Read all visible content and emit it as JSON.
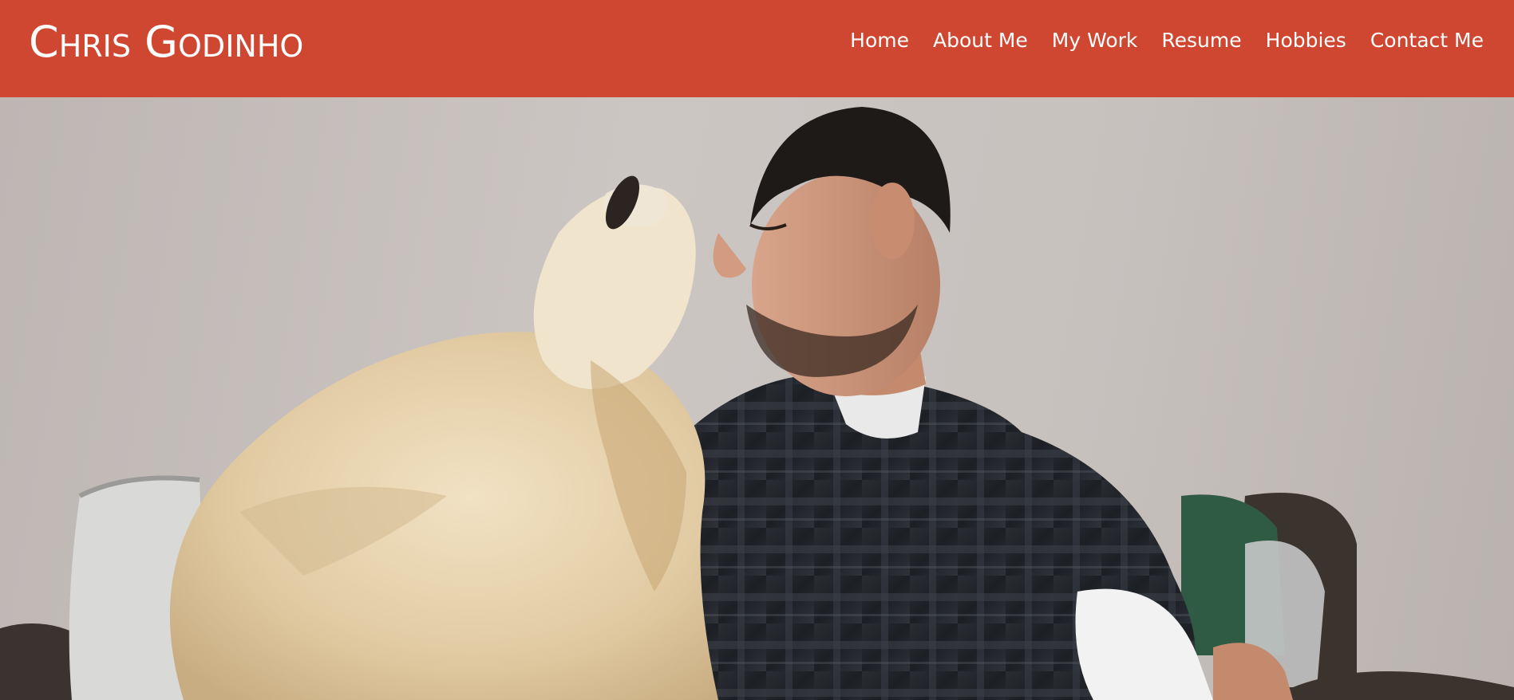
{
  "site": {
    "title": "Chris Godinho"
  },
  "nav": {
    "items": [
      {
        "label": "Home"
      },
      {
        "label": "About Me"
      },
      {
        "label": "My Work"
      },
      {
        "label": "Resume"
      },
      {
        "label": "Hobbies"
      },
      {
        "label": "Contact Me"
      }
    ]
  },
  "colors": {
    "header_bg": "#cf4631",
    "header_text": "#ffffff",
    "wall": "#c9c3c0"
  },
  "hero": {
    "image_subject": "man-with-dog-photo"
  }
}
